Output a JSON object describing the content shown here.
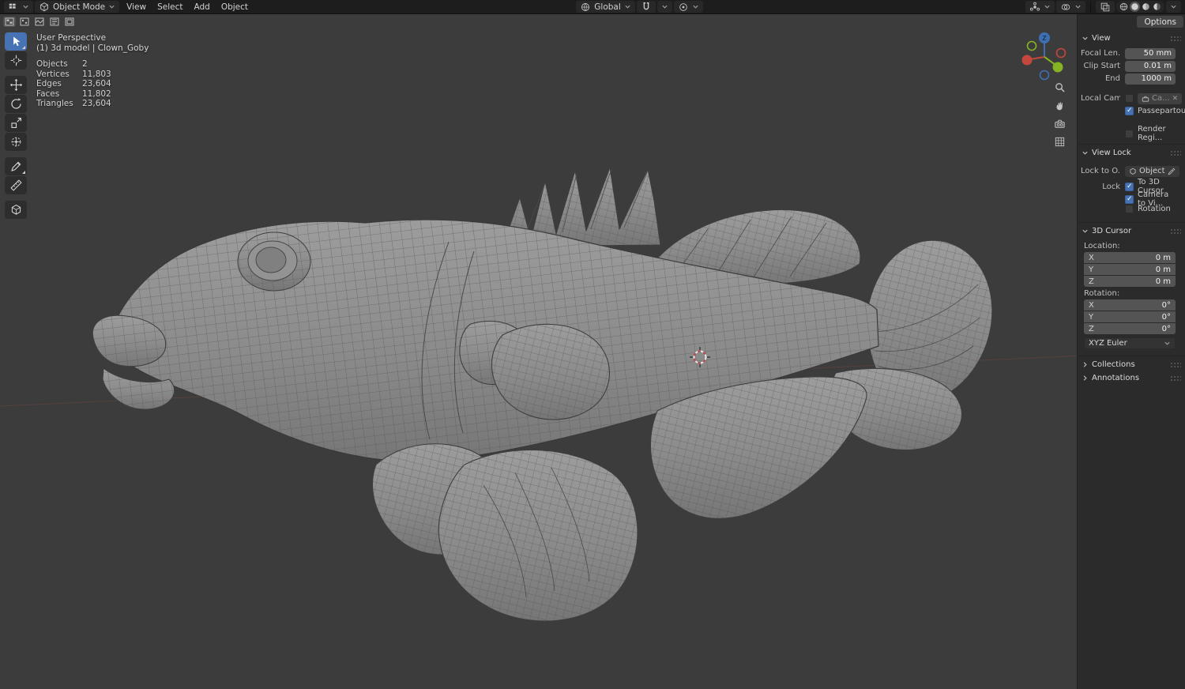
{
  "topbar": {
    "mode_label": "Object Mode",
    "menus": [
      "View",
      "Select",
      "Add",
      "Object"
    ],
    "orientation_label": "Global",
    "options_label": "Options"
  },
  "viewport": {
    "perspective_label": "User Perspective",
    "scene_label": "(1) 3d model | Clown_Goby",
    "stats": [
      {
        "label": "Objects",
        "value": "2"
      },
      {
        "label": "Vertices",
        "value": "11,803"
      },
      {
        "label": "Edges",
        "value": "23,604"
      },
      {
        "label": "Faces",
        "value": "11,802"
      },
      {
        "label": "Triangles",
        "value": "23,604"
      }
    ]
  },
  "sidebar": {
    "view": {
      "title": "View",
      "focal_label": "Focal Len...",
      "focal_value": "50 mm",
      "clip_start_label": "Clip Start",
      "clip_start_value": "0.01 m",
      "clip_end_label": "End",
      "clip_end_value": "1000 m",
      "local_camera_label": "Local Cam...",
      "local_camera_value": "Ca...",
      "passepartout_label": "Passepartout",
      "render_region_label": "Render Regi...",
      "checks": {
        "local_camera": false,
        "passepartout": true,
        "render_region": false
      }
    },
    "view_lock": {
      "title": "View Lock",
      "lock_to_label": "Lock to O...",
      "lock_object_value": "Object",
      "lock_label": "Lock",
      "to_3d_cursor_label": "To 3D Cursor",
      "camera_to_view_label": "Camera to Vi...",
      "rotation_label": "Rotation",
      "checks": {
        "to_3d_cursor": true,
        "camera_to_view": true,
        "rotation": false
      }
    },
    "cursor3d": {
      "title": "3D Cursor",
      "location_label": "Location:",
      "rotation_label": "Rotation:",
      "location": [
        {
          "axis": "X",
          "value": "0 m"
        },
        {
          "axis": "Y",
          "value": "0 m"
        },
        {
          "axis": "Z",
          "value": "0 m"
        }
      ],
      "rotation": [
        {
          "axis": "X",
          "value": "0°"
        },
        {
          "axis": "Y",
          "value": "0°"
        },
        {
          "axis": "Z",
          "value": "0°"
        }
      ],
      "euler_label": "XYZ Euler"
    },
    "collections_title": "Collections",
    "annotations_title": "Annotations"
  },
  "colors": {
    "accent": "#4772b3",
    "axis_x": "#c4473d",
    "axis_y": "#86b324",
    "axis_z": "#3f6fb3"
  }
}
